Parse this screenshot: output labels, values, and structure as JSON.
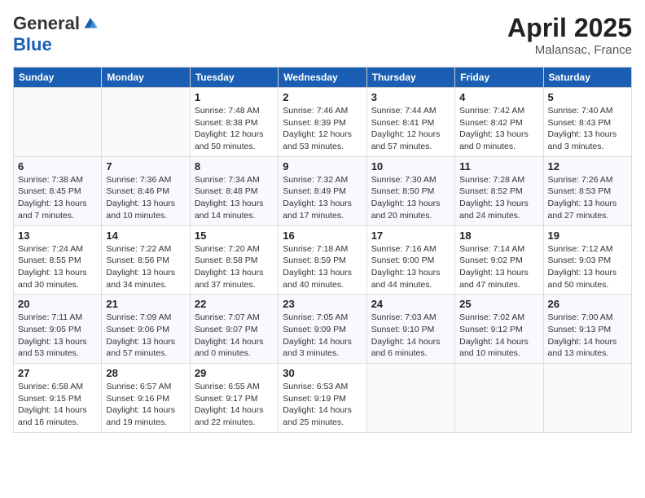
{
  "header": {
    "logo_general": "General",
    "logo_blue": "Blue",
    "month_title": "April 2025",
    "location": "Malansac, France"
  },
  "weekdays": [
    "Sunday",
    "Monday",
    "Tuesday",
    "Wednesday",
    "Thursday",
    "Friday",
    "Saturday"
  ],
  "weeks": [
    [
      {
        "day": null
      },
      {
        "day": null
      },
      {
        "day": "1",
        "sunrise": "Sunrise: 7:48 AM",
        "sunset": "Sunset: 8:38 PM",
        "daylight": "Daylight: 12 hours and 50 minutes."
      },
      {
        "day": "2",
        "sunrise": "Sunrise: 7:46 AM",
        "sunset": "Sunset: 8:39 PM",
        "daylight": "Daylight: 12 hours and 53 minutes."
      },
      {
        "day": "3",
        "sunrise": "Sunrise: 7:44 AM",
        "sunset": "Sunset: 8:41 PM",
        "daylight": "Daylight: 12 hours and 57 minutes."
      },
      {
        "day": "4",
        "sunrise": "Sunrise: 7:42 AM",
        "sunset": "Sunset: 8:42 PM",
        "daylight": "Daylight: 13 hours and 0 minutes."
      },
      {
        "day": "5",
        "sunrise": "Sunrise: 7:40 AM",
        "sunset": "Sunset: 8:43 PM",
        "daylight": "Daylight: 13 hours and 3 minutes."
      }
    ],
    [
      {
        "day": "6",
        "sunrise": "Sunrise: 7:38 AM",
        "sunset": "Sunset: 8:45 PM",
        "daylight": "Daylight: 13 hours and 7 minutes."
      },
      {
        "day": "7",
        "sunrise": "Sunrise: 7:36 AM",
        "sunset": "Sunset: 8:46 PM",
        "daylight": "Daylight: 13 hours and 10 minutes."
      },
      {
        "day": "8",
        "sunrise": "Sunrise: 7:34 AM",
        "sunset": "Sunset: 8:48 PM",
        "daylight": "Daylight: 13 hours and 14 minutes."
      },
      {
        "day": "9",
        "sunrise": "Sunrise: 7:32 AM",
        "sunset": "Sunset: 8:49 PM",
        "daylight": "Daylight: 13 hours and 17 minutes."
      },
      {
        "day": "10",
        "sunrise": "Sunrise: 7:30 AM",
        "sunset": "Sunset: 8:50 PM",
        "daylight": "Daylight: 13 hours and 20 minutes."
      },
      {
        "day": "11",
        "sunrise": "Sunrise: 7:28 AM",
        "sunset": "Sunset: 8:52 PM",
        "daylight": "Daylight: 13 hours and 24 minutes."
      },
      {
        "day": "12",
        "sunrise": "Sunrise: 7:26 AM",
        "sunset": "Sunset: 8:53 PM",
        "daylight": "Daylight: 13 hours and 27 minutes."
      }
    ],
    [
      {
        "day": "13",
        "sunrise": "Sunrise: 7:24 AM",
        "sunset": "Sunset: 8:55 PM",
        "daylight": "Daylight: 13 hours and 30 minutes."
      },
      {
        "day": "14",
        "sunrise": "Sunrise: 7:22 AM",
        "sunset": "Sunset: 8:56 PM",
        "daylight": "Daylight: 13 hours and 34 minutes."
      },
      {
        "day": "15",
        "sunrise": "Sunrise: 7:20 AM",
        "sunset": "Sunset: 8:58 PM",
        "daylight": "Daylight: 13 hours and 37 minutes."
      },
      {
        "day": "16",
        "sunrise": "Sunrise: 7:18 AM",
        "sunset": "Sunset: 8:59 PM",
        "daylight": "Daylight: 13 hours and 40 minutes."
      },
      {
        "day": "17",
        "sunrise": "Sunrise: 7:16 AM",
        "sunset": "Sunset: 9:00 PM",
        "daylight": "Daylight: 13 hours and 44 minutes."
      },
      {
        "day": "18",
        "sunrise": "Sunrise: 7:14 AM",
        "sunset": "Sunset: 9:02 PM",
        "daylight": "Daylight: 13 hours and 47 minutes."
      },
      {
        "day": "19",
        "sunrise": "Sunrise: 7:12 AM",
        "sunset": "Sunset: 9:03 PM",
        "daylight": "Daylight: 13 hours and 50 minutes."
      }
    ],
    [
      {
        "day": "20",
        "sunrise": "Sunrise: 7:11 AM",
        "sunset": "Sunset: 9:05 PM",
        "daylight": "Daylight: 13 hours and 53 minutes."
      },
      {
        "day": "21",
        "sunrise": "Sunrise: 7:09 AM",
        "sunset": "Sunset: 9:06 PM",
        "daylight": "Daylight: 13 hours and 57 minutes."
      },
      {
        "day": "22",
        "sunrise": "Sunrise: 7:07 AM",
        "sunset": "Sunset: 9:07 PM",
        "daylight": "Daylight: 14 hours and 0 minutes."
      },
      {
        "day": "23",
        "sunrise": "Sunrise: 7:05 AM",
        "sunset": "Sunset: 9:09 PM",
        "daylight": "Daylight: 14 hours and 3 minutes."
      },
      {
        "day": "24",
        "sunrise": "Sunrise: 7:03 AM",
        "sunset": "Sunset: 9:10 PM",
        "daylight": "Daylight: 14 hours and 6 minutes."
      },
      {
        "day": "25",
        "sunrise": "Sunrise: 7:02 AM",
        "sunset": "Sunset: 9:12 PM",
        "daylight": "Daylight: 14 hours and 10 minutes."
      },
      {
        "day": "26",
        "sunrise": "Sunrise: 7:00 AM",
        "sunset": "Sunset: 9:13 PM",
        "daylight": "Daylight: 14 hours and 13 minutes."
      }
    ],
    [
      {
        "day": "27",
        "sunrise": "Sunrise: 6:58 AM",
        "sunset": "Sunset: 9:15 PM",
        "daylight": "Daylight: 14 hours and 16 minutes."
      },
      {
        "day": "28",
        "sunrise": "Sunrise: 6:57 AM",
        "sunset": "Sunset: 9:16 PM",
        "daylight": "Daylight: 14 hours and 19 minutes."
      },
      {
        "day": "29",
        "sunrise": "Sunrise: 6:55 AM",
        "sunset": "Sunset: 9:17 PM",
        "daylight": "Daylight: 14 hours and 22 minutes."
      },
      {
        "day": "30",
        "sunrise": "Sunrise: 6:53 AM",
        "sunset": "Sunset: 9:19 PM",
        "daylight": "Daylight: 14 hours and 25 minutes."
      },
      {
        "day": null
      },
      {
        "day": null
      },
      {
        "day": null
      }
    ]
  ]
}
